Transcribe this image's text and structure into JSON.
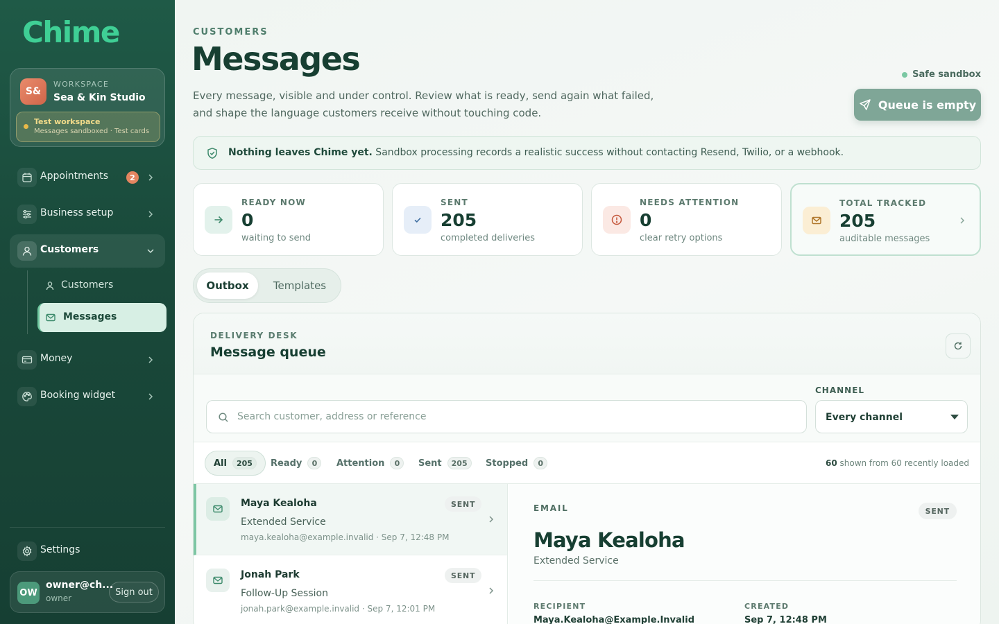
{
  "app": {
    "logo": "Chime"
  },
  "workspace": {
    "initials": "S&",
    "label": "WORKSPACE",
    "name": "Sea & Kin Studio",
    "test_title": "Test workspace",
    "test_sub": "Messages sandboxed · Test cards"
  },
  "nav": {
    "appointments": {
      "label": "Appointments",
      "badge": "2"
    },
    "business_setup": {
      "label": "Business setup"
    },
    "customers": {
      "label": "Customers"
    },
    "sub_customers": {
      "label": "Customers"
    },
    "sub_messages": {
      "label": "Messages"
    },
    "money": {
      "label": "Money"
    },
    "booking_widget": {
      "label": "Booking widget"
    },
    "settings": {
      "label": "Settings"
    }
  },
  "user": {
    "initials": "OW",
    "email": "owner@ch...",
    "role": "owner",
    "signout_label": "Sign out"
  },
  "header": {
    "eyebrow": "CUSTOMERS",
    "title": "Messages",
    "description": "Every message, visible and under control. Review what is ready, send again what failed, and shape the language customers receive without touching code.",
    "sandbox_status": "Safe sandbox",
    "queue_button": "Queue is empty"
  },
  "banner": {
    "bold": "Nothing leaves Chime yet.",
    "text": " Sandbox processing records a realistic success without contacting Resend, Twilio, or a webhook."
  },
  "stats": [
    {
      "label": "READY NOW",
      "value": "0",
      "sub": "waiting to send"
    },
    {
      "label": "SENT",
      "value": "205",
      "sub": "completed deliveries"
    },
    {
      "label": "NEEDS ATTENTION",
      "value": "0",
      "sub": "clear retry options"
    },
    {
      "label": "TOTAL TRACKED",
      "value": "205",
      "sub": "auditable messages"
    }
  ],
  "tabs": {
    "outbox": "Outbox",
    "templates": "Templates"
  },
  "panel": {
    "eyebrow": "DELIVERY DESK",
    "title": "Message queue",
    "search_placeholder": "Search customer, address or reference",
    "channel_label": "CHANNEL",
    "channel_value": "Every channel"
  },
  "filters": [
    {
      "label": "All",
      "count": "205"
    },
    {
      "label": "Ready",
      "count": "0"
    },
    {
      "label": "Attention",
      "count": "0"
    },
    {
      "label": "Sent",
      "count": "205"
    },
    {
      "label": "Stopped",
      "count": "0"
    }
  ],
  "shown": {
    "count": "60",
    "text": " shown from 60 recently loaded"
  },
  "messages": [
    {
      "name": "Maya Kealoha",
      "service": "Extended Service",
      "meta": "maya.kealoha@example.invalid · Sep 7, 12:48 PM",
      "status": "SENT"
    },
    {
      "name": "Jonah Park",
      "service": "Follow-Up Session",
      "meta": "jonah.park@example.invalid · Sep 7, 12:01 PM",
      "status": "SENT"
    }
  ],
  "detail": {
    "channel": "EMAIL",
    "status": "SENT",
    "name": "Maya Kealoha",
    "service": "Extended Service",
    "recipient_label": "RECIPIENT",
    "recipient_value": "Maya.Kealoha@Example.Invalid",
    "created_label": "CREATED",
    "created_value": "Sep 7, 12:48 PM"
  },
  "colors": {
    "brand": "#3fcf95",
    "sidebar": "#1f5a47",
    "accent": "#7dc6a4",
    "badge": "#e38560"
  }
}
